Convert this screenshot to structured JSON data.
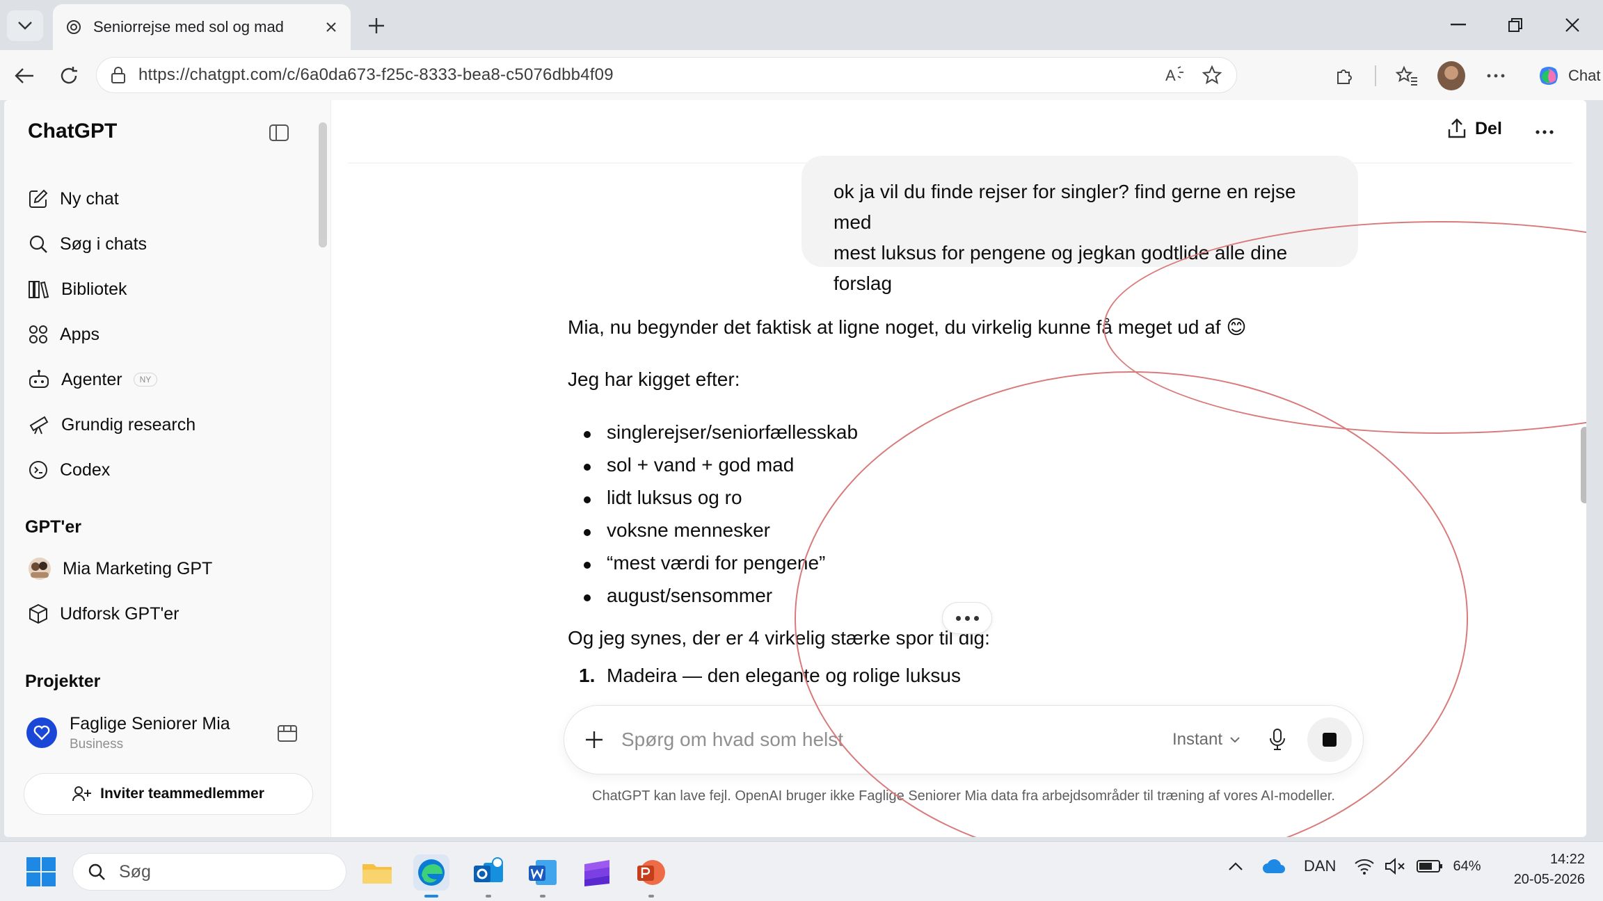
{
  "browser": {
    "tab_title": "Seniorrejse med sol og mad",
    "url": "https://chatgpt.com/c/6a0da673-f25c-8333-bea8-c5076dbb4f09",
    "copilot_label": "Chat"
  },
  "sidebar": {
    "brand": "ChatGPT",
    "items": [
      {
        "label": "Ny chat",
        "icon": "pencil-square-icon"
      },
      {
        "label": "Søg i chats",
        "icon": "search-icon"
      },
      {
        "label": "Bibliotek",
        "icon": "library-icon"
      },
      {
        "label": "Apps",
        "icon": "apps-grid-icon"
      },
      {
        "label": "Agenter",
        "icon": "robot-icon",
        "badge": "NY"
      },
      {
        "label": "Grundig research",
        "icon": "telescope-icon"
      },
      {
        "label": "Codex",
        "icon": "codex-icon"
      }
    ],
    "gpts_heading": "GPT'er",
    "gpts": [
      {
        "label": "Mia Marketing GPT",
        "icon": "gpt-avatar-icon"
      },
      {
        "label": "Udforsk GPT'er",
        "icon": "cube-icon"
      }
    ],
    "projects_heading": "Projekter",
    "project": {
      "name": "Faglige Seniorer Mia",
      "sub": "Business"
    },
    "invite_label": "Inviter teammedlemmer"
  },
  "main": {
    "share_label": "Del",
    "user_message_lines": [
      "ok ja vil du finde rejser for singler? find gerne en rejse med",
      "mest luksus for pengene og jegkan godtlide alle dine",
      "forslag"
    ],
    "assistant": {
      "intro": "Mia, nu begynder det faktisk at ligne noget, du virkelig kunne få meget ud af 😊",
      "lead": "Jeg har kigget efter:",
      "bullets": [
        "singlerejser/seniorfællesskab",
        "sol + vand + god mad",
        "lidt luksus og ro",
        "voksne mennesker",
        "“mest værdi for pengene”",
        "august/sensommer"
      ],
      "summary": "Og jeg synes, der er 4 virkelig stærke spor til dig:",
      "numbered": [
        {
          "n": "1.",
          "text": "Madeira — den elegante og rolige luksus"
        }
      ]
    },
    "composer": {
      "placeholder": "Spørg om hvad som helst",
      "model": "Instant"
    },
    "disclaimer": "ChatGPT kan lave fejl. OpenAI bruger ikke Faglige Seniorer Mia data fra arbejdsområder til træning af vores AI-modeller."
  },
  "taskbar": {
    "search_label": "Søg",
    "language": "DAN",
    "battery": "64%",
    "time": "14:22",
    "date": "20-05-2026"
  },
  "colors": {
    "annotation_red": "#d97a7a",
    "project_blue": "#1a47d8"
  }
}
